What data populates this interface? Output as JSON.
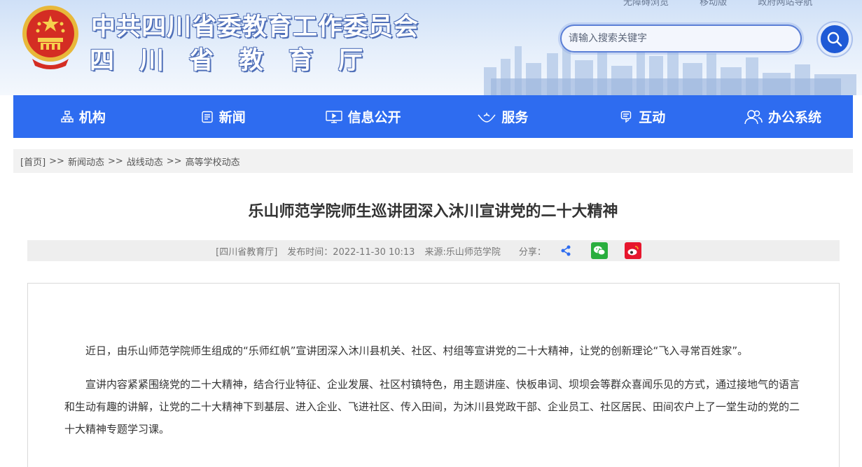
{
  "header": {
    "top_links": [
      "无障碍浏览",
      "移动版",
      "政府网站导航"
    ],
    "title": "中共四川省委教育工作委员会",
    "subtitle": "四川省教育厅",
    "search_placeholder": "请输入搜索关键字"
  },
  "nav": {
    "items": [
      {
        "label": "机构",
        "icon": "org-chart-icon"
      },
      {
        "label": "新闻",
        "icon": "news-icon"
      },
      {
        "label": "信息公开",
        "icon": "monitor-icon"
      },
      {
        "label": "服务",
        "icon": "service-hands-icon"
      },
      {
        "label": "互动",
        "icon": "chat-icon"
      },
      {
        "label": "办公系统",
        "icon": "users-icon"
      }
    ],
    "color": "#2e6cf0"
  },
  "breadcrumb": {
    "home": "[首页]",
    "sep": ">>",
    "items": [
      "新闻动态",
      "战线动态",
      "高等学校动态"
    ]
  },
  "article": {
    "title": "乐山师范学院师生巡讲团深入沐川宣讲党的二十大精神",
    "meta": {
      "source_tag": "[四川省教育厅]",
      "publish": "发布时间：2022-11-30 10:13",
      "origin": "来源:乐山师范学院",
      "share_label": "分享："
    },
    "paragraphs": [
      "近日，由乐山师范学院师生组成的“乐师红帆”宣讲团深入沐川县机关、社区、村组等宣讲党的二十大精神，让党的创新理论“飞入寻常百姓家”。",
      "宣讲内容紧紧围绕党的二十大精神，结合行业特征、企业发展、社区村镇特色，用主题讲座、快板串词、坝坝会等群众喜闻乐见的方式，通过接地气的语言和生动有趣的讲解，让党的二十大精神下到基层、进入企业、飞进社区、传入田间，为沐川县党政干部、企业员工、社区居民、田间农户上了一堂生动的党的二十大精神专题学习课。"
    ]
  }
}
